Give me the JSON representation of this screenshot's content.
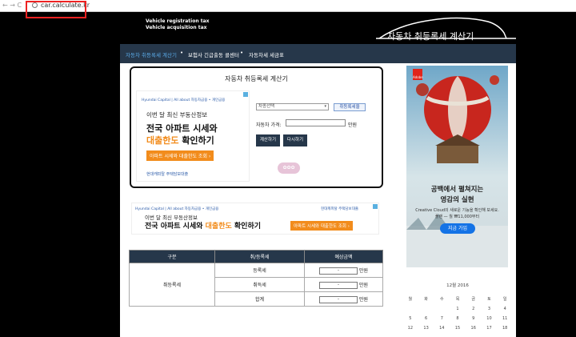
{
  "browser": {
    "nav_icons": "← → C",
    "url": "car.calculate.kr"
  },
  "header": {
    "line1": "Vehicle registration tax",
    "line2": "Vehicle acquisition tax",
    "brand": "자동차 취등록세 계산기"
  },
  "nav": {
    "items": [
      {
        "label": "자동차 취등록세 계산기",
        "active": true
      },
      {
        "label": "보험사 긴급출동 콜센터",
        "active": false
      },
      {
        "label": "자동차세 세금표",
        "active": false
      }
    ],
    "separator": "•"
  },
  "calculator": {
    "title": "자동차 취등록세 계산기",
    "car_type_select": "차종선택",
    "car_type_button": "취등록세율",
    "price_label": "자동차 가격:",
    "price_unit": "만원",
    "calculate_button": "계산하기",
    "reset_button": "다시하기"
  },
  "ad_small": {
    "logo": "Hyundai Capital",
    "logo_tail": "All about 자동차금융 • 개인금융",
    "line1": "이번 달 최신 부동산정보",
    "line2a": "전국 아파트 시세와",
    "line2b": "대출한도",
    "line2c": " 확인하기",
    "button": "아파트 시세와 대출한도 조회 ›",
    "footer": "현대캐피탈 주택담보대출"
  },
  "ad_banner": {
    "logo": "Hyundai Capital",
    "logo_tail": "All about 자동차금융 • 개인금융",
    "top_right": "현대캐피탈 주택담보대출",
    "line1": "이번 달 최신 부동산정보",
    "line2a": "전국 아파트 시세와 ",
    "line2b": "대출한도",
    "line2c": " 확인하기",
    "button": "아파트 시세와 대출한도 조회 ›"
  },
  "fees_table": {
    "headers": [
      "구분",
      "취/등록세",
      "예상금액"
    ],
    "group_label": "취등록세",
    "rows": [
      {
        "label": "등록세",
        "value": "-",
        "unit": "만원"
      },
      {
        "label": "취득세",
        "value": "-",
        "unit": "만원"
      },
      {
        "label": "합계",
        "value": "-",
        "unit": "만원"
      }
    ]
  },
  "ad_adobe": {
    "brand": "Adobe",
    "headline1": "공백에서 펼쳐지는",
    "headline2": "영감의 실현",
    "body1": "Creative Cloud의 새로운 기능을 확인해 보세요.",
    "body2": "플랜 — 월 ₩11,000부터",
    "cta": "지금 가입"
  },
  "calendar": {
    "caption": "12월 2016",
    "weekdays": [
      "월",
      "화",
      "수",
      "목",
      "금",
      "토",
      "일"
    ],
    "weeks": [
      [
        "",
        "",
        "",
        "1",
        "2",
        "3",
        "4"
      ],
      [
        "5",
        "6",
        "7",
        "8",
        "9",
        "10",
        "11"
      ],
      [
        "12",
        "13",
        "14",
        "15",
        "16",
        "17",
        "18"
      ]
    ]
  },
  "colors": {
    "nav_bg": "#26374a",
    "accent_orange": "#f28c1c",
    "active_nav": "#5aa9e6"
  }
}
